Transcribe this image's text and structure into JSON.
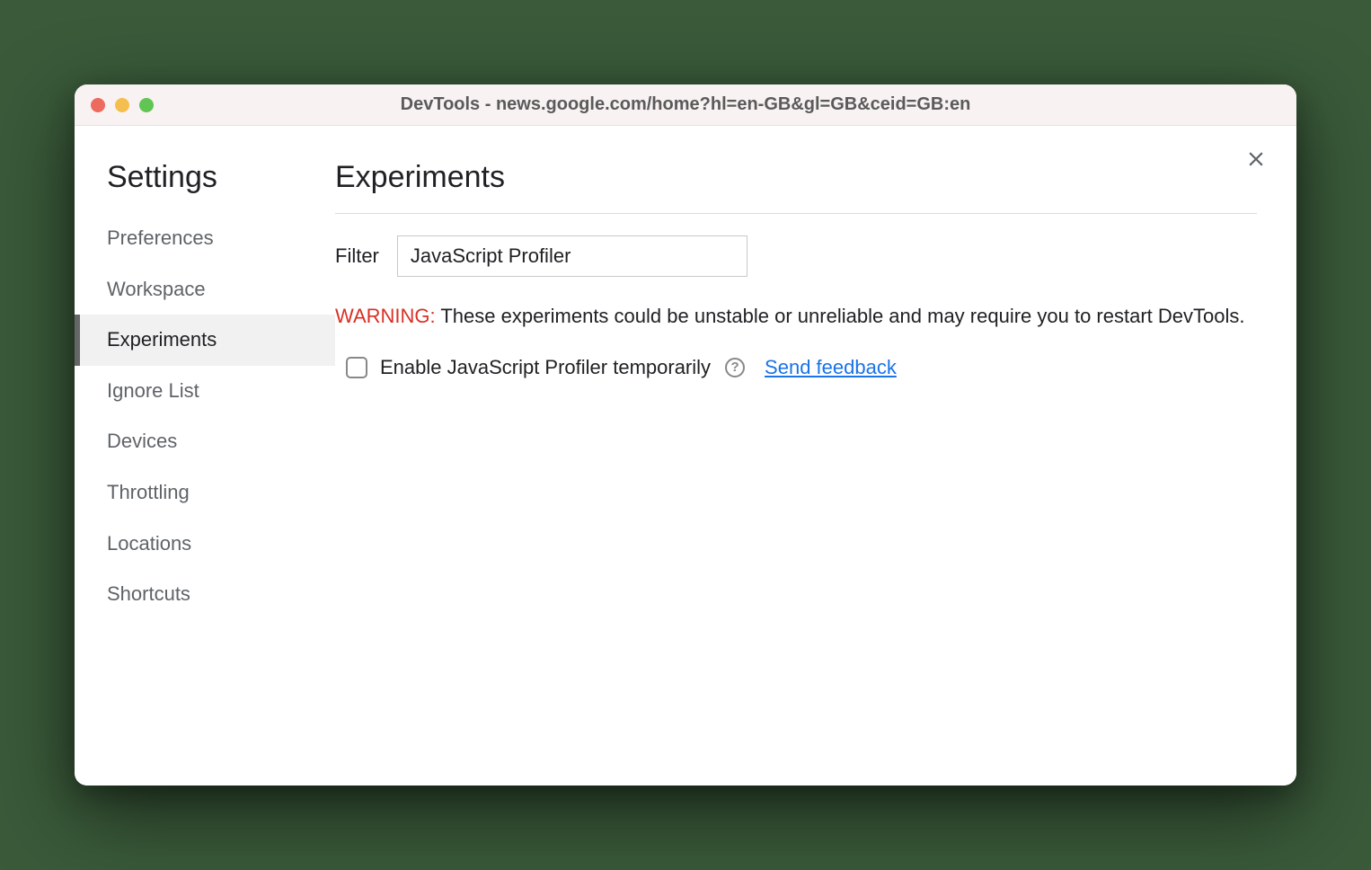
{
  "window": {
    "title": "DevTools - news.google.com/home?hl=en-GB&gl=GB&ceid=GB:en"
  },
  "sidebar": {
    "title": "Settings",
    "items": [
      {
        "label": "Preferences"
      },
      {
        "label": "Workspace"
      },
      {
        "label": "Experiments"
      },
      {
        "label": "Ignore List"
      },
      {
        "label": "Devices"
      },
      {
        "label": "Throttling"
      },
      {
        "label": "Locations"
      },
      {
        "label": "Shortcuts"
      }
    ],
    "selected_index": 2
  },
  "main": {
    "title": "Experiments",
    "filter_label": "Filter",
    "filter_value": "JavaScript Profiler",
    "warning_prefix": "WARNING:",
    "warning_text": " These experiments could be unstable or unreliable and may require you to restart DevTools.",
    "experiment": {
      "checked": false,
      "label": "Enable JavaScript Profiler temporarily",
      "help_glyph": "?",
      "feedback_label": "Send feedback"
    }
  }
}
